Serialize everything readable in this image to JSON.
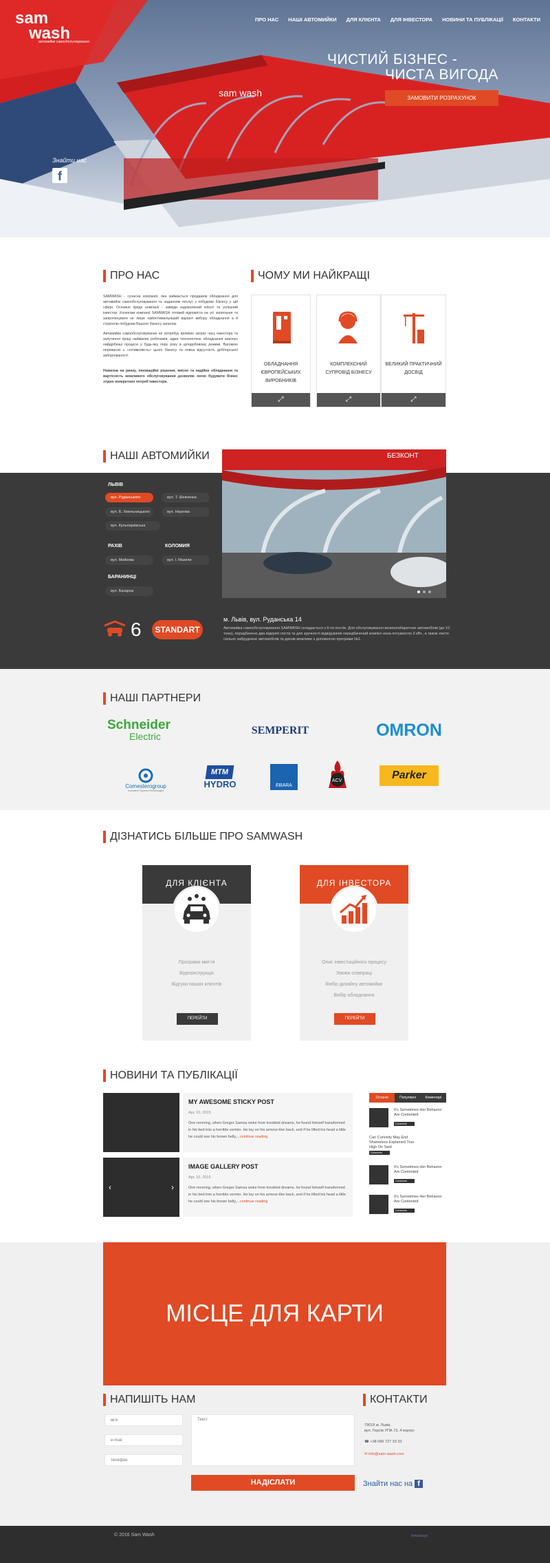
{
  "nav": {
    "items": [
      "ПРО НАС",
      "НАШІ АВТОМИЙКИ",
      "ДЛЯ КЛІЄНТА",
      "ДЛЯ ІНВЕСТОРА",
      "НОВИНИ ТА ПУБЛІКАЦІЇ",
      "КОНТАКТИ"
    ]
  },
  "logo": {
    "line1": "sam",
    "line2": "wash",
    "tagline": "автомийки самообслуговування"
  },
  "hero": {
    "title_line1": "ЧИСТИЙ БІЗНЕС -",
    "title_line2": "ЧИСТА ВИГОДА",
    "button": "ЗАМОВИТИ РОЗРАХУНОК",
    "canopy_brand": "sam wash",
    "find_us": "Знайти нас",
    "fb_icon": "f"
  },
  "about": {
    "title": "ПРО НАС",
    "p1": "SAMWASH - сучасна компанія, яка займається продажем обладнання для автомийок самообслуговування та наданням послуг з побудови бізнесу у цій сфері. Основне кредо компанії - завжди задоволений клієнт та успішний інвестор. Колектив компанії SAMWASH готовий відповісти на усі запитання та запропонувати не лише найоптимальніший варіант вибору обладнання а й стратегію побудови Вашого бізнесу загалом.",
    "p2": "Автомийка самообслуговування не потребує великих затрат часу інвестора та залучення праці найманих робітників, адже технологічне обладнання виконує найдрібніші процеси у будь-яку пору року в цілодобовому режимі. Вагомою перевагою є «готивковість» цього бізнесу та повна відсутність дебіторської заборгованості.",
    "p3": "Новизна на ринку, інноваційні рішення, якісне та надійне обладнання та вартісність можливого обслуговування дозволяє легко будувати бізнес згідно конкретних потреб інвестора."
  },
  "why": {
    "title": "ЧОМУ МИ НАЙКРАЩІ",
    "cards": [
      {
        "label": "ОБЛАДНАННЯ ЄВРОПЕЙСЬКИХ ВИРОБНИКІВ",
        "icon": "machine-icon",
        "foot": "⤢"
      },
      {
        "label": "КОМПЛЕКСНИЙ СУПРОВІД БІЗНЕСУ",
        "icon": "support-agent-icon",
        "foot": "⤢"
      },
      {
        "label": "ВЕЛИКИЙ ПРАКТИЧНИЙ ДОСВІД",
        "icon": "crane-icon",
        "foot": "⤢"
      }
    ]
  },
  "washes": {
    "title": "НАШІ АВТОМИЙКИ",
    "cities": [
      {
        "name": "ЛЬВІВ",
        "streets": [
          "вул. Руданського",
          "вул. Т. Шевченка",
          "вул. Б. Хмельницького",
          "вул. Наукова",
          "вул. Кульпарківська"
        ]
      },
      {
        "name": "РАХІВ",
        "streets": [
          "вул. Мийкова"
        ]
      },
      {
        "name": "КОЛОМИЯ",
        "streets": [
          "вул. І. Мазепи"
        ]
      },
      {
        "name": "БАРАНИНЦІ",
        "streets": [
          "вул. Базарна"
        ]
      }
    ],
    "photo_banner": "БЕЗКОНТ",
    "count": "6",
    "standart": "STANDART",
    "address": "м. Львів, вул. Руданська 14",
    "desc": "Автомийка самообслуговування SAMWASH складається з 6-ти постів. Для обслуговування великогабаритних автомобілів (до 10 тонн), передбачено два відкриті пости та для зручності відвідувачів передбачений кемпінг-зона потужністю 3 кВт., а також листя сильно забруднене автомобілів та дисків можливе з допомогою програми №1."
  },
  "partners": {
    "title": "НАШІ ПАРТНЕРИ",
    "logos": [
      "Schneider Electric",
      "SEMPERIT",
      "OMRON",
      "Comesterogroup",
      "MTM HYDRO",
      "EBARA",
      "ACV",
      "Parker"
    ],
    "schneider_line1": "Schneider",
    "schneider_line2": "Electric",
    "comestero_sub": "Innovative Payment Technologies",
    "mtm_line1": "MTM",
    "mtm_line2": "HYDRO"
  },
  "learn": {
    "title": "ДІЗНАТИСЬ БІЛЬШЕ ПРО SAMWASH",
    "client": {
      "title": "ДЛЯ КЛІЄНТА",
      "links": [
        "Програми миття",
        "Відеоінструкція",
        "Відгуки наших клієнтів"
      ],
      "button": "ПЕРЕЙТИ",
      "color": "#3a3a3a",
      "icon": "car-wash-icon"
    },
    "investor": {
      "title": "ДЛЯ ІНВЕСТОРА",
      "links": [
        "Опис інвестиційного процесу",
        "Умови співпраці",
        "Вибір дизайну автомийки",
        "Вибір обладнання"
      ],
      "button": "ПЕРЕЙТИ",
      "color": "#e04a24",
      "icon": "growth-chart-icon"
    }
  },
  "news": {
    "title": "НОВИНИ ТА ПУБЛІКАЦІЇ",
    "posts": [
      {
        "title": "MY AWESOME STICKY POST",
        "date": "Арг. 10, 2015",
        "text": "One morning, when Gregor Samsa woke from troubled dreams, he found himself transformed in his bed into a horrible vermin. He lay on his armour-like back, and if he lifted his head a little he could see his brown belly,...",
        "more": "continue reading"
      },
      {
        "title": "IMAGE GALLERY POST",
        "date": "Арг. 10, 2015",
        "text": "One morning, when Gregor Samsa woke from troubled dreams, he found himself transformed in his bed into a horrible vermin. He lay on his armour-like back, and if he lifted his head a little he could see his brown belly,...",
        "more": "continue reading"
      }
    ],
    "tabs": [
      "Останні",
      "Популярні",
      "Коментарі"
    ],
    "widget": [
      {
        "title": "It's Sometimes Her Behavior Are Contented",
        "badge": "Comments"
      },
      {
        "title": "Can Curiosity May End Shameless Explained True High On Said",
        "badge": "Comments"
      },
      {
        "title": "It's Sometimes Her Behavior Are Contented",
        "badge": "Comments"
      },
      {
        "title": "It's Sometimes Her Behavior Are Contented",
        "badge": "Comments"
      }
    ]
  },
  "map": {
    "label": "МІСЦЕ ДЛЯ КАРТИ"
  },
  "form": {
    "title": "НАПИШІТЬ НАМ",
    "name_placeholder": "ім'я",
    "email_placeholder": "e-mail",
    "phone_placeholder": "телефон",
    "text_placeholder": "Текст",
    "send": "НАДІСЛАТИ"
  },
  "contacts": {
    "title": "КОНТАКТИ",
    "address1": "79018 м. Львів,",
    "address2": "вул. Героїв УПА 73, 4 корпус",
    "phone1": "+38 096 727 33 33",
    "phone2": "",
    "email": "info@sam-wash.com",
    "find_us": "Знайти нас на"
  },
  "footer": {
    "copy": "© 2016  Sam Wash",
    "dev": "Artwebsign"
  },
  "colors": {
    "accent": "#e04a24",
    "dark": "#3a3a3a"
  }
}
